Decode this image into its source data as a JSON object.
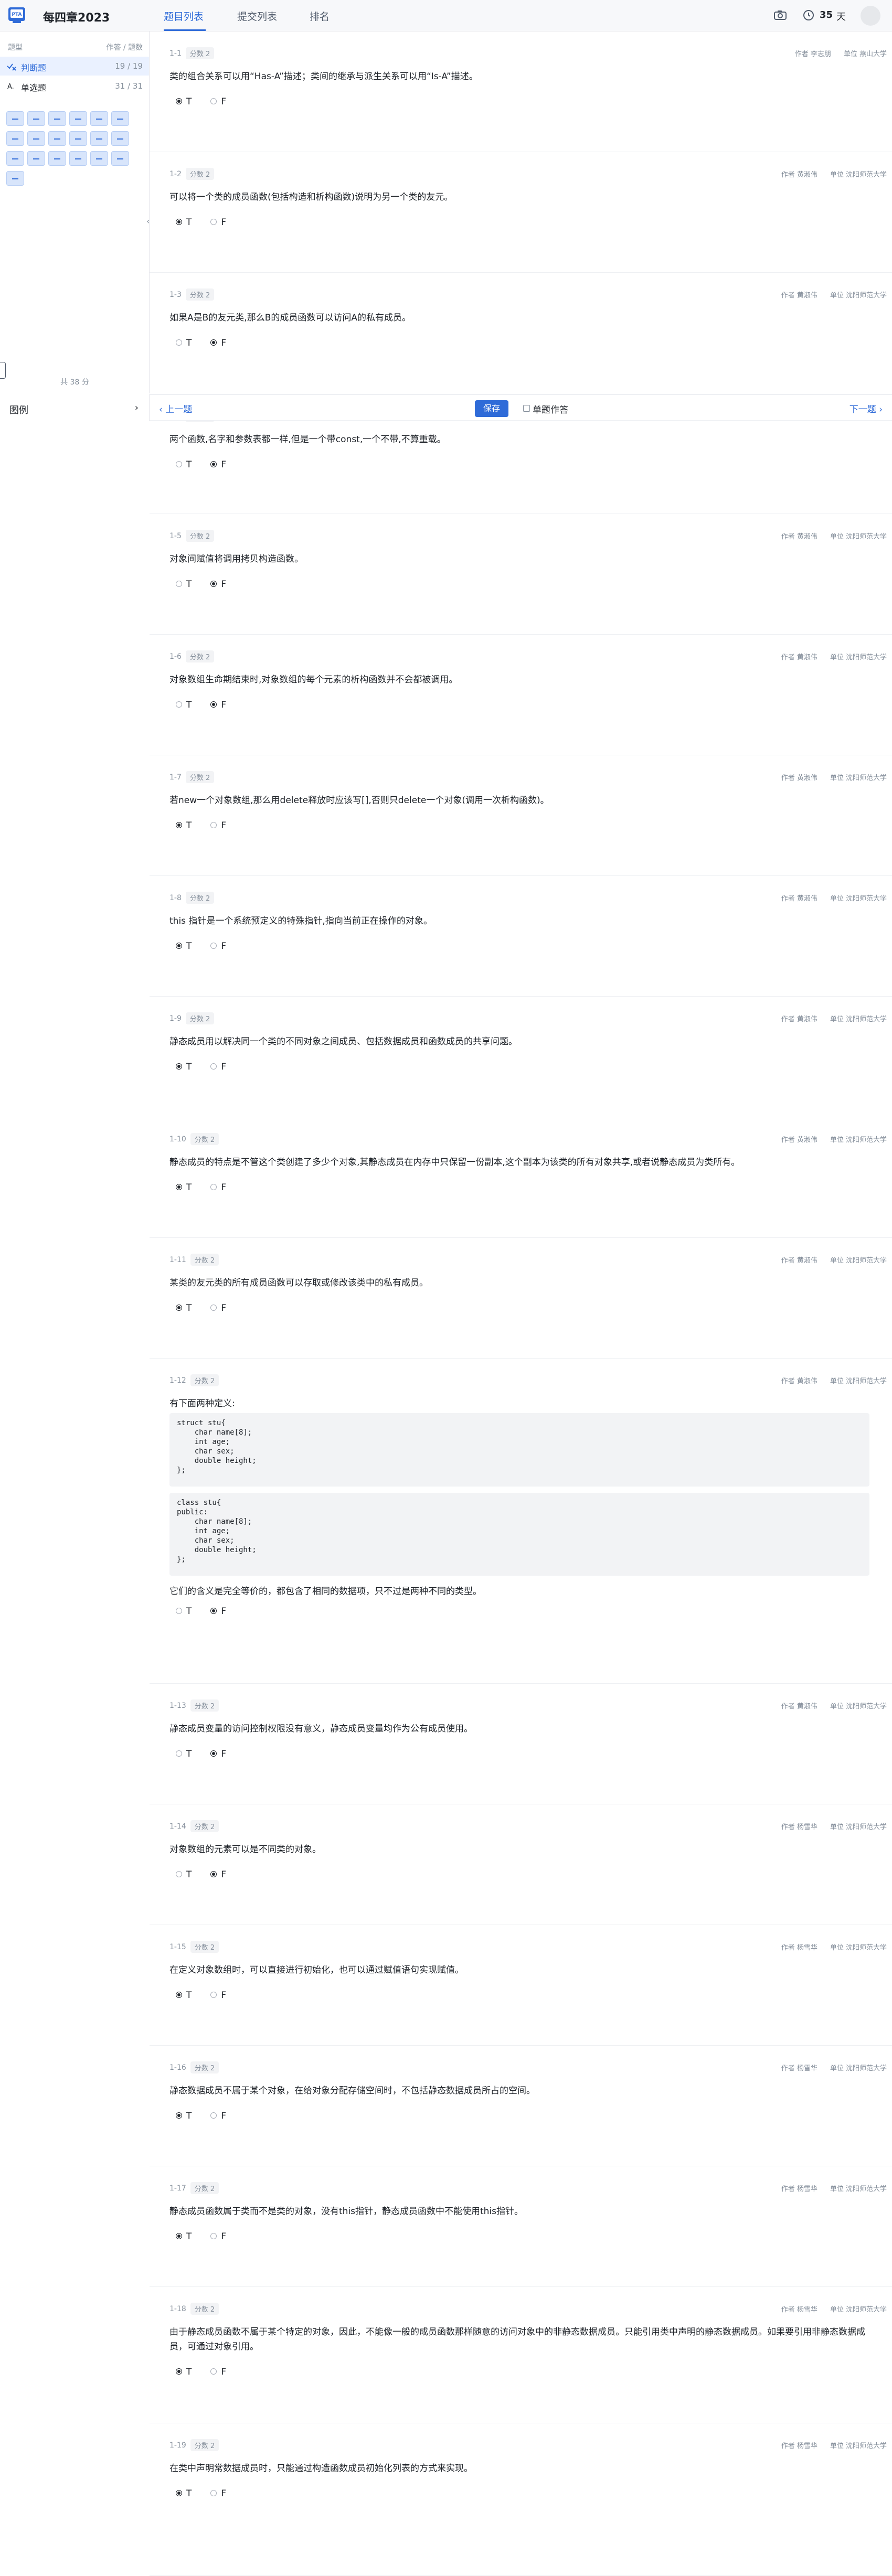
{
  "header": {
    "title": "每四章2023",
    "tabs": [
      {
        "label": "题目列表",
        "active": true
      },
      {
        "label": "提交列表",
        "active": false
      },
      {
        "label": "排名",
        "active": false
      }
    ],
    "camera_icon": "camera-icon",
    "clock_icon": "clock-icon",
    "days_count": "35",
    "days_unit": "天",
    "accent_color": "#2f6bd8"
  },
  "sidebar": {
    "type_header": "题型",
    "count_header": "作答 / 题数",
    "rows": [
      {
        "label": "判断题",
        "count": "19 / 19",
        "icon": "true-false-icon",
        "active": true
      },
      {
        "label": "单选题",
        "count": "31 / 31",
        "icon": "single-choice-icon",
        "active": false
      }
    ],
    "grid_cells": 19,
    "total_score": "共 38 分",
    "legend_label": "图例",
    "collapse_icon": "chevron-left-icon"
  },
  "action_bar": {
    "prev": "上一题",
    "save": "保存",
    "single_mode": "单题作答",
    "next": "下一题"
  },
  "questions": [
    {
      "num": "1-1",
      "score": "分数 2",
      "author": "作者 李志朋",
      "unit": "单位 燕山大学",
      "text": "类的组合关系可以用“Has-A”描述；类间的继承与派生关系可以用“Is-A”描述。",
      "answer": "T"
    },
    {
      "num": "1-2",
      "score": "分数 2",
      "author": "作者 黄淑伟",
      "unit": "单位 沈阳师范大学",
      "text": "可以将一个类的成员函数(包括构造和析构函数)说明为另一个类的友元。",
      "answer": "T"
    },
    {
      "num": "1-3",
      "score": "分数 2",
      "author": "作者 黄淑伟",
      "unit": "单位 沈阳师范大学",
      "text": "如果A是B的友元类,那么B的成员函数可以访问A的私有成员。",
      "answer": "F"
    },
    {
      "num": "1-4",
      "score": "分数 2",
      "author": "作者 黄淑伟",
      "unit": "单位 沈阳师范大学",
      "text": "两个函数,名字和参数表都一样,但是一个带const,一个不带,不算重载。",
      "answer": "F"
    },
    {
      "num": "1-5",
      "score": "分数 2",
      "author": "作者 黄淑伟",
      "unit": "单位 沈阳师范大学",
      "text": "对象间赋值将调用拷贝构造函数。",
      "answer": "F"
    },
    {
      "num": "1-6",
      "score": "分数 2",
      "author": "作者 黄淑伟",
      "unit": "单位 沈阳师范大学",
      "text": "对象数组生命期结束时,对象数组的每个元素的析构函数并不会都被调用。",
      "answer": "F"
    },
    {
      "num": "1-7",
      "score": "分数 2",
      "author": "作者 黄淑伟",
      "unit": "单位 沈阳师范大学",
      "text": "若new一个对象数组,那么用delete释放时应该写[],否则只delete一个对象(调用一次析构函数)。",
      "answer": "T"
    },
    {
      "num": "1-8",
      "score": "分数 2",
      "author": "作者 黄淑伟",
      "unit": "单位 沈阳师范大学",
      "text": "this 指针是一个系统预定义的特殊指针,指向当前正在操作的对象。",
      "answer": "T"
    },
    {
      "num": "1-9",
      "score": "分数 2",
      "author": "作者 黄淑伟",
      "unit": "单位 沈阳师范大学",
      "text": "静态成员用以解决同一个类的不同对象之间成员、包括数据成员和函数成员的共享问题。",
      "answer": "T"
    },
    {
      "num": "1-10",
      "score": "分数 2",
      "author": "作者 黄淑伟",
      "unit": "单位 沈阳师范大学",
      "text": "静态成员的特点是不管这个类创建了多少个对象,其静态成员在内存中只保留一份副本,这个副本为该类的所有对象共享,或者说静态成员为类所有。",
      "answer": "T"
    },
    {
      "num": "1-11",
      "score": "分数 2",
      "author": "作者 黄淑伟",
      "unit": "单位 沈阳师范大学",
      "text": "某类的友元类的所有成员函数可以存取或修改该类中的私有成员。",
      "answer": "T"
    },
    {
      "num": "1-12",
      "score": "分数 2",
      "author": "作者 黄淑伟",
      "unit": "单位 沈阳师范大学",
      "text": "有下面两种定义:",
      "code1": "struct stu{\n    char name[8];\n    int age;\n    char sex;\n    double height;\n};",
      "code2": "class stu{\npublic:\n    char name[8];\n    int age;\n    char sex;\n    double height;\n};",
      "text2": "它们的含义是完全等价的，都包含了相同的数据项，只不过是两种不同的类型。",
      "answer": "F"
    },
    {
      "num": "1-13",
      "score": "分数 2",
      "author": "作者 黄淑伟",
      "unit": "单位 沈阳师范大学",
      "text": "静态成员变量的访问控制权限没有意义，静态成员变量均作为公有成员使用。",
      "answer": "F"
    },
    {
      "num": "1-14",
      "score": "分数 2",
      "author": "作者 杨雪华",
      "unit": "单位 沈阳师范大学",
      "text": "对象数组的元素可以是不同类的对象。",
      "answer": "F"
    },
    {
      "num": "1-15",
      "score": "分数 2",
      "author": "作者 杨雪华",
      "unit": "单位 沈阳师范大学",
      "text": "在定义对象数组时，可以直接进行初始化，也可以通过赋值语句实现赋值。",
      "answer": "T"
    },
    {
      "num": "1-16",
      "score": "分数 2",
      "author": "作者 杨雪华",
      "unit": "单位 沈阳师范大学",
      "text": "静态数据成员不属于某个对象，在给对象分配存储空间时，不包括静态数据成员所占的空间。",
      "answer": "T"
    },
    {
      "num": "1-17",
      "score": "分数 2",
      "author": "作者 杨雪华",
      "unit": "单位 沈阳师范大学",
      "text": "静态成员函数属于类而不是类的对象，没有this指针，静态成员函数中不能使用this指针。",
      "answer": "T"
    },
    {
      "num": "1-18",
      "score": "分数 2",
      "author": "作者 杨雪华",
      "unit": "单位 沈阳师范大学",
      "text": "由于静态成员函数不属于某个特定的对象，因此，不能像一般的成员函数那样随意的访问对象中的非静态数据成员。只能引用类中声明的静态数据成员。如果要引用非静态数据成员，可通过对象引用。",
      "answer": "T"
    },
    {
      "num": "1-19",
      "score": "分数 2",
      "author": "作者 杨雪华",
      "unit": "单位 沈阳师范大学",
      "text": "在类中声明常数据成员时，只能通过构造函数成员初始化列表的方式来实现。",
      "answer": "T"
    }
  ],
  "option_labels": [
    "T",
    "F"
  ]
}
